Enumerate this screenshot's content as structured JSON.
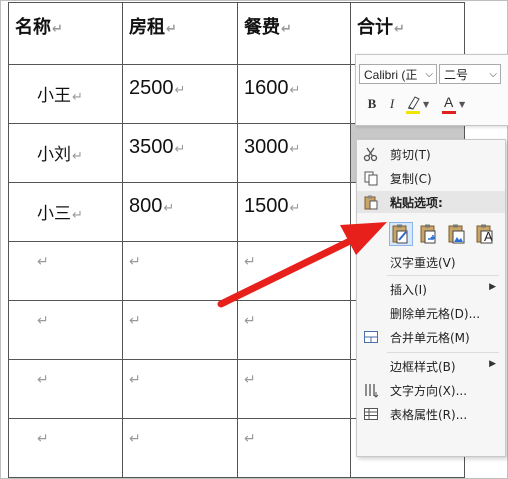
{
  "table": {
    "headers": [
      "名称",
      "房租",
      "餐费",
      "合计"
    ],
    "rows": [
      [
        "小王",
        "2500",
        "1600",
        ""
      ],
      [
        "小刘",
        "3500",
        "3000",
        ""
      ],
      [
        "小三",
        "800",
        "1500",
        ""
      ]
    ],
    "paragraph_mark": "↵"
  },
  "mini_toolbar": {
    "font_name": "Calibri (正",
    "font_size": "二号",
    "bold": "B",
    "italic": "I",
    "font_color_glyph": "A",
    "highlight_color": "#f5e400",
    "font_color": "#e02020"
  },
  "context_menu": {
    "items": [
      {
        "label": "剪切(T)",
        "icon": "scissors-icon"
      },
      {
        "label": "复制(C)",
        "icon": "copy-icon"
      },
      {
        "label": "粘贴选项:",
        "icon": "clipboard-icon"
      },
      {
        "label": "汉字重选(V)",
        "icon": ""
      },
      {
        "label": "插入(I)",
        "icon": "",
        "submenu": true
      },
      {
        "label": "删除单元格(D)...",
        "icon": ""
      },
      {
        "label": "合并单元格(M)",
        "icon": "merge-cells-icon"
      },
      {
        "label": "边框样式(B)",
        "icon": "",
        "submenu": true
      },
      {
        "label": "文字方向(X)...",
        "icon": "text-direction-icon"
      },
      {
        "label": "表格属性(R)...",
        "icon": "table-properties-icon"
      }
    ],
    "paste_options": [
      "keep-source-format-icon",
      "merge-format-icon",
      "picture-icon",
      "keep-text-only-icon"
    ],
    "paste_text_glyph": "A"
  },
  "annotation": {
    "arrow_color": "#e8201c"
  }
}
